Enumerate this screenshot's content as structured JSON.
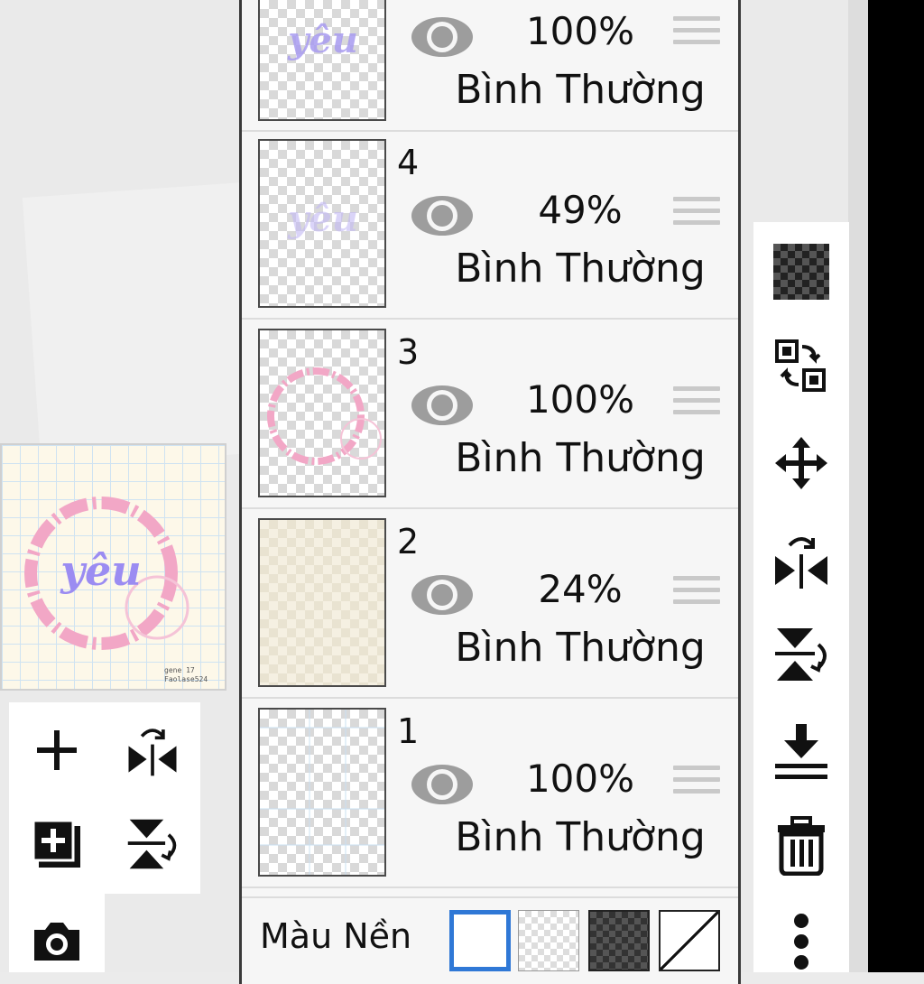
{
  "layers": [
    {
      "num": "",
      "opacity": "100%",
      "blend": "Bình Thường",
      "thumb_text": "yêu"
    },
    {
      "num": "4",
      "opacity": "49%",
      "blend": "Bình Thường",
      "thumb_text": "yêu"
    },
    {
      "num": "3",
      "opacity": "100%",
      "blend": "Bình Thường"
    },
    {
      "num": "2",
      "opacity": "24%",
      "blend": "Bình Thường"
    },
    {
      "num": "1",
      "opacity": "100%",
      "blend": "Bình Thường"
    }
  ],
  "background": {
    "label": "Màu Nền",
    "options": [
      "white",
      "transparent",
      "dark-checker",
      "none"
    ],
    "selected": "white"
  },
  "preview": {
    "art_text": "yêu",
    "signature": "gene 17\nFaolase524"
  },
  "right_tools": [
    "transparency-lock-icon",
    "swap-layers-icon",
    "move-icon",
    "flip-horizontal-icon",
    "flip-vertical-icon",
    "merge-down-icon",
    "trash-icon",
    "more-vertical-icon"
  ],
  "left_tools": [
    "add-layer-icon",
    "flip-horizontal-icon",
    "add-layer-copy-icon",
    "flip-vertical-icon",
    "camera-icon"
  ],
  "colors": {
    "accent": "#2f78d6",
    "panel": "#f6f6f6",
    "pink": "#f2a7c6",
    "purple": "#9b8cf2"
  }
}
